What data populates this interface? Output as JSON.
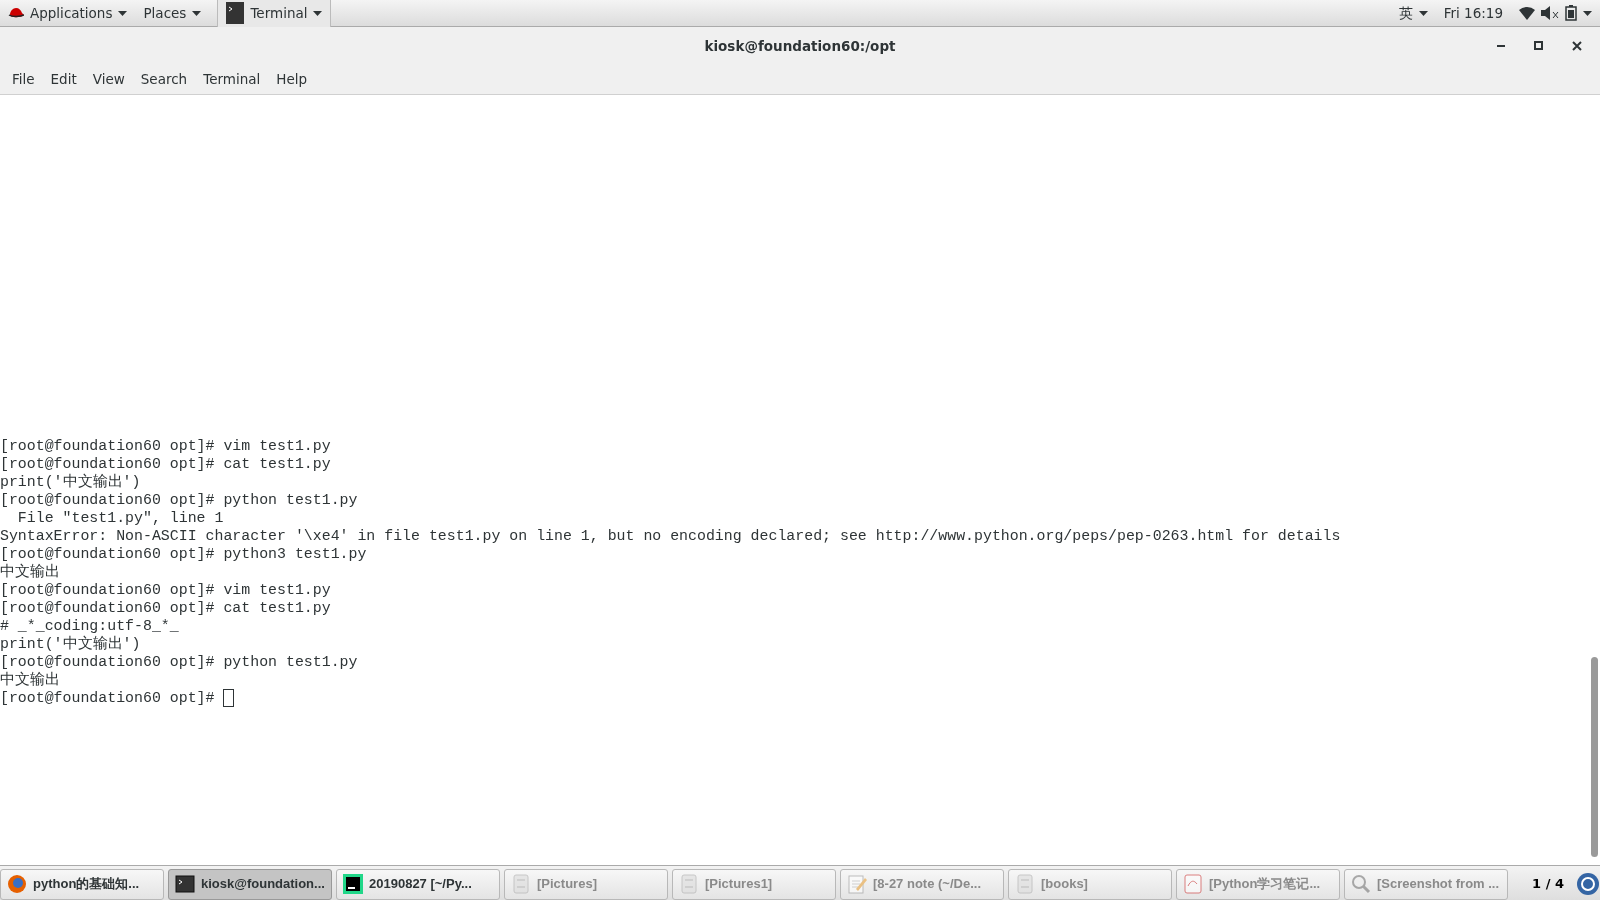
{
  "top_bar": {
    "menus": [
      {
        "label": "Applications"
      },
      {
        "label": "Places"
      }
    ],
    "app": "Terminal",
    "input_method": "英",
    "clock": "Fri 16:19"
  },
  "window": {
    "title": "kiosk@foundation60:/opt",
    "menu": [
      "File",
      "Edit",
      "View",
      "Search",
      "Terminal",
      "Help"
    ]
  },
  "terminal": {
    "lines": [
      "[root@foundation60 opt]# vim test1.py",
      "[root@foundation60 opt]# cat test1.py",
      "print('中文输出')",
      "[root@foundation60 opt]# python test1.py",
      "  File \"test1.py\", line 1",
      "SyntaxError: Non-ASCII character '\\xe4' in file test1.py on line 1, but no encoding declared; see http://www.python.org/peps/pep-0263.html for details",
      "[root@foundation60 opt]# python3 test1.py",
      "中文输出",
      "[root@foundation60 opt]# vim test1.py",
      "[root@foundation60 opt]# cat test1.py",
      "# _*_coding:utf-8_*_",
      "print('中文输出')",
      "[root@foundation60 opt]# python test1.py",
      "中文输出",
      "[root@foundation60 opt]# "
    ]
  },
  "taskbar": {
    "items": [
      {
        "label": "python的基础知...",
        "kind": "browser",
        "selected": false,
        "minimized": false
      },
      {
        "label": "kiosk@foundation...",
        "kind": "terminal",
        "selected": true,
        "minimized": false
      },
      {
        "label": "20190827 [~/Py...",
        "kind": "ide",
        "selected": false,
        "minimized": false
      },
      {
        "label": "[Pictures]",
        "kind": "files",
        "selected": false,
        "minimized": true
      },
      {
        "label": "[Pictures1]",
        "kind": "files",
        "selected": false,
        "minimized": true
      },
      {
        "label": "[8-27 note (~/De...",
        "kind": "editor",
        "selected": false,
        "minimized": true
      },
      {
        "label": "[books]",
        "kind": "files",
        "selected": false,
        "minimized": true
      },
      {
        "label": "[Python学习笔记...",
        "kind": "document",
        "selected": false,
        "minimized": true
      },
      {
        "label": "[Screenshot from ...",
        "kind": "viewer",
        "selected": false,
        "minimized": true
      }
    ],
    "workspace": "1 / 4"
  }
}
